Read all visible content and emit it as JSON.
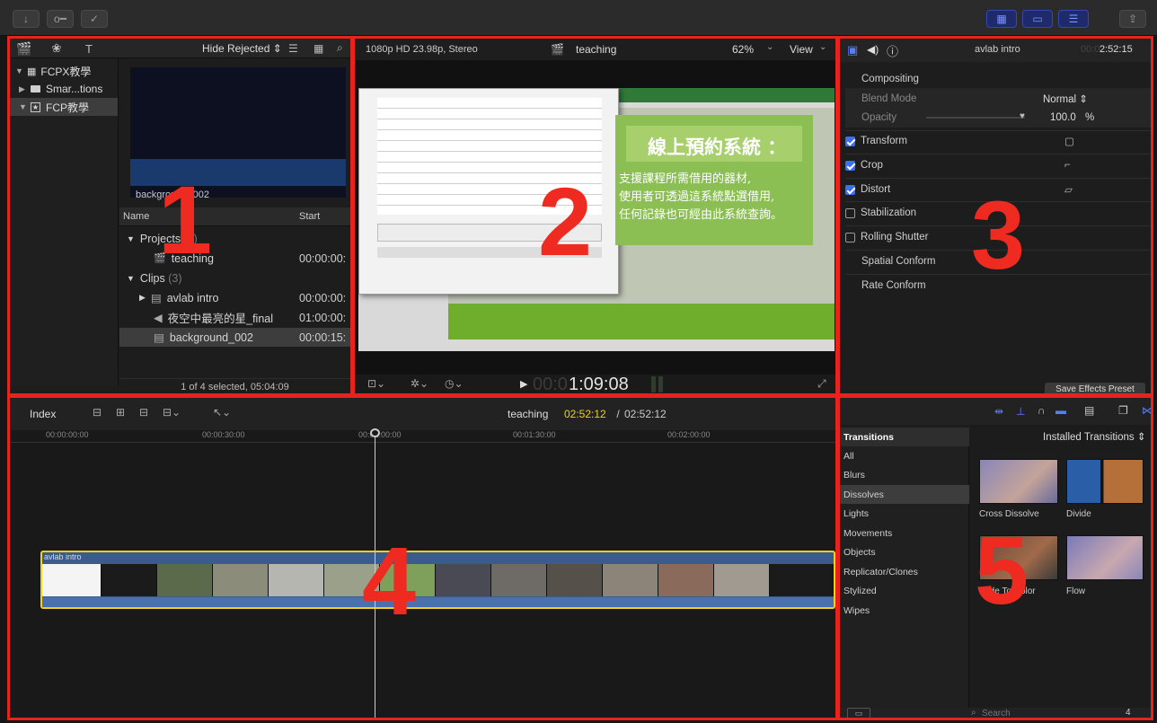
{
  "titlebar": {
    "left_icons": [
      "import-icon",
      "keyword-icon",
      "check-icon"
    ],
    "right_icons": [
      "library-toggle-icon",
      "timeline-toggle-icon",
      "inspector-toggle-icon",
      "share-icon"
    ]
  },
  "labels": {
    "p1": "1",
    "p2": "2",
    "p3": "3",
    "p4": "4",
    "p5": "5"
  },
  "browser": {
    "library_items": [
      {
        "label": "FCPX教學",
        "expanded": true
      },
      {
        "label": "Smar...tions"
      },
      {
        "label": "FCP教學",
        "selected": true
      }
    ],
    "filter": "Hide Rejected ⇕",
    "filmstrip_caption": "background_002",
    "columns": {
      "name": "Name",
      "start": "Start"
    },
    "rows": [
      {
        "name": "Projects",
        "count": "(1)",
        "start": "",
        "type": "group"
      },
      {
        "name": "teaching",
        "start": "00:00:00:",
        "type": "project"
      },
      {
        "name": "Clips",
        "count": "(3)",
        "start": "",
        "type": "group"
      },
      {
        "name": "avlab intro",
        "start": "00:00:00:",
        "type": "clip"
      },
      {
        "name": "夜空中最亮的星_final",
        "start": "01:00:00:",
        "type": "audio"
      },
      {
        "name": "background_002",
        "start": "00:00:15:",
        "type": "clip",
        "selected": true
      }
    ],
    "status": "1 of 4 selected, 05:04:09"
  },
  "viewer": {
    "format": "1080p HD 23.98p, Stereo",
    "project": "teaching",
    "zoom": "62%",
    "view": "View",
    "timecode_dim": "00:0",
    "timecode": "1:09:08",
    "video_title": "線上預約系統 ：",
    "video_text": [
      "支援課程所需借用的器材,",
      "使用者可透過這系統點選借用,",
      "任何記錄也可經由此系統查詢。"
    ]
  },
  "inspector": {
    "clip_name": "avlab intro",
    "duration_dim": "00:0",
    "duration": "2:52:15",
    "compositing": "Compositing",
    "blend_mode_label": "Blend Mode",
    "blend_mode_value": "Normal ⇕",
    "opacity_label": "Opacity",
    "opacity_value": "100.0",
    "opacity_unit": "%",
    "sections": [
      {
        "label": "Transform",
        "checked": true
      },
      {
        "label": "Crop",
        "checked": true
      },
      {
        "label": "Distort",
        "checked": true
      },
      {
        "label": "Stabilization",
        "checked": false
      },
      {
        "label": "Rolling Shutter",
        "checked": false
      },
      {
        "label": "Spatial Conform",
        "checked": null
      },
      {
        "label": "Rate Conform",
        "checked": null
      }
    ],
    "save_preset": "Save Effects Preset"
  },
  "timeline": {
    "index": "Index",
    "project": "teaching",
    "tc_current": "02:52:12",
    "tc_sep": " / ",
    "tc_total": "02:52:12",
    "ruler": [
      "00:00:00:00",
      "00:00:30:00",
      "00:01:00:00",
      "00:01:30:00",
      "00:02:00:00"
    ],
    "clip_label": "avlab intro",
    "playhead_pct": 0.442
  },
  "browser5": {
    "header": "Transitions",
    "dropdown": "Installed Transitions ⇕",
    "categories": [
      "All",
      "Blurs",
      "Dissolves",
      "Lights",
      "Movements",
      "Objects",
      "Replicator/Clones",
      "Stylized",
      "Wipes"
    ],
    "selected_category": "Dissolves",
    "items": [
      "Cross Dissolve",
      "Divide",
      "Fade To Color",
      "Flow"
    ],
    "search_placeholder": "Search",
    "count": "4 items"
  },
  "colors": {
    "accent_red": "#e8231b",
    "blue": "#3b6ff7",
    "yellow": "#f2d21b",
    "timeline_clip": "#3a5b8e"
  }
}
